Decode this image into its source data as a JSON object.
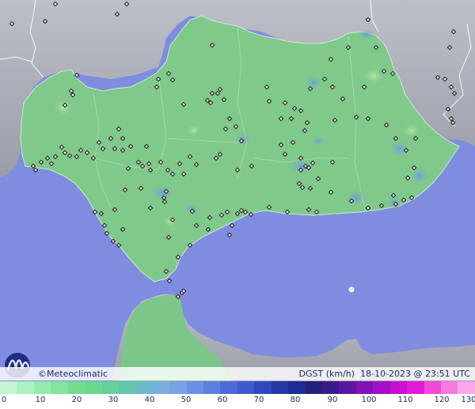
{
  "footer": {
    "brand": "Meteoclimatic",
    "copyright_symbol": "©",
    "variable": "DGST (km/h)",
    "datetime": "18-10-2023 @ 23:51 UTC"
  },
  "legend": {
    "ticks": [
      "0",
      "10",
      "20",
      "30",
      "40",
      "50",
      "60",
      "70",
      "80",
      "90",
      "100",
      "110",
      "120",
      "130"
    ],
    "ramp_colors": [
      "#c6f5d4",
      "#aef0c2",
      "#95ebaf",
      "#83e59f",
      "#72dd90",
      "#6bd88c",
      "#67cf9a",
      "#66c6aa",
      "#6db9c9",
      "#79aee0",
      "#7aa0e8",
      "#6c8fe6",
      "#5c7ee0",
      "#4d6bd8",
      "#3f5acf",
      "#3048bf",
      "#2338a8",
      "#1b2c94",
      "#22207e",
      "#3a1a88",
      "#5b16a0",
      "#8012b6",
      "#a40fc6",
      "#c80fd4",
      "#e21ad7",
      "#f04bd8",
      "#f77ae0",
      "#fba6ea"
    ]
  },
  "colors": {
    "sea": "#7f8ce0",
    "land_andalucia": "#7fc98b",
    "land_other": "#a8aab4",
    "station_marker": "#111111"
  }
}
